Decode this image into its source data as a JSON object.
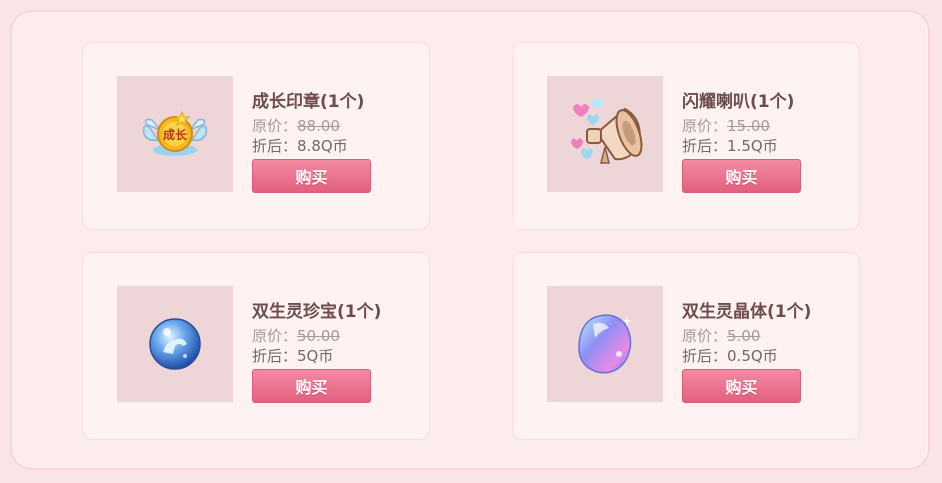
{
  "colors": {
    "button": "#e2607f",
    "card": "#fff2f3",
    "thumb_bg": "#edd5d8"
  },
  "items": [
    {
      "title": "成长印章(1个)",
      "orig_label": "原价：",
      "orig_price": "88.00",
      "disc_label": "折后：",
      "disc_price": "8.8Q币",
      "buy_label": "购买",
      "icon": "growth-seal-icon"
    },
    {
      "title": "闪耀喇叭(1个)",
      "orig_label": "原价：",
      "orig_price": "15.00",
      "disc_label": "折后：",
      "disc_price": "1.5Q币",
      "buy_label": "购买",
      "icon": "sparkle-horn-icon"
    },
    {
      "title": "双生灵珍宝(1个)",
      "orig_label": "原价：",
      "orig_price": "50.00",
      "disc_label": "折后：",
      "disc_price": "5Q币",
      "buy_label": "购买",
      "icon": "crystal-orb-icon"
    },
    {
      "title": "双生灵晶体(1个)",
      "orig_label": "原价：",
      "orig_price": "5.00",
      "disc_label": "折后：",
      "disc_price": "0.5Q币",
      "buy_label": "购买",
      "icon": "spirit-crystal-icon"
    }
  ]
}
